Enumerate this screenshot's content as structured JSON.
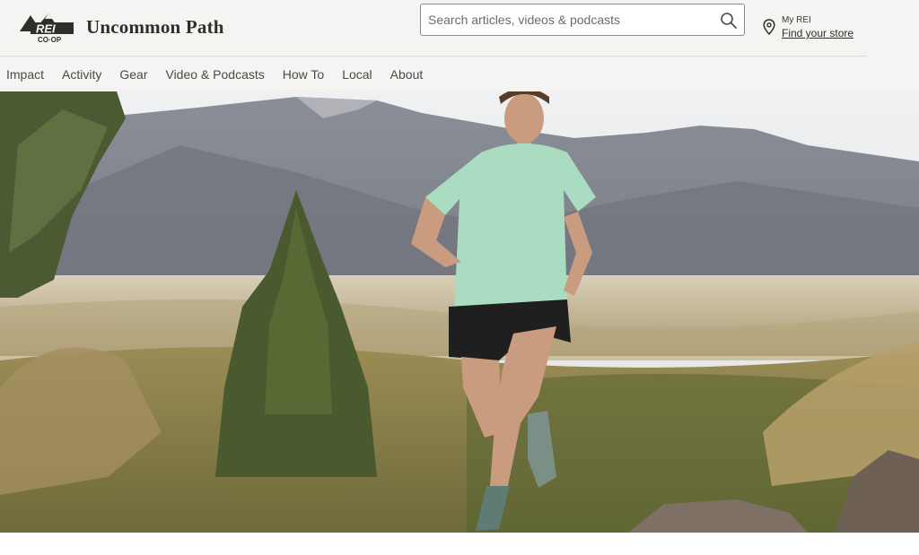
{
  "header": {
    "logo": {
      "brand": "REI",
      "sub": "CO-OP"
    },
    "site_title": "Uncommon Path"
  },
  "search": {
    "placeholder": "Search articles, videos & podcasts",
    "icon": "search-icon"
  },
  "store": {
    "label": "My REI",
    "link": "Find your store",
    "icon": "location-pin-icon"
  },
  "nav": {
    "items": [
      {
        "label": "Impact"
      },
      {
        "label": "Activity"
      },
      {
        "label": "Gear"
      },
      {
        "label": "Video & Podcasts"
      },
      {
        "label": "How To"
      },
      {
        "label": "Local"
      },
      {
        "label": "About"
      }
    ]
  },
  "colors": {
    "header_bg": "#f5f4f2",
    "text_dark": "#2e2e2b",
    "shirt": "#a9dcc1"
  }
}
